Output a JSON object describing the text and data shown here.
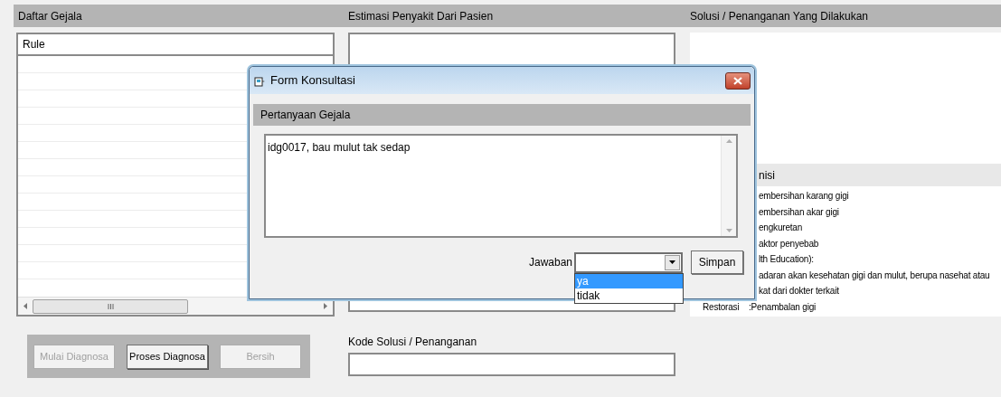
{
  "left_panel": {
    "title": "Daftar Gejala",
    "list": {
      "column": "Rule"
    },
    "buttons": [
      {
        "label": "Mulai Diagnosa",
        "disabled": true
      },
      {
        "label": "Proses Diagnosa",
        "disabled": false
      },
      {
        "label": "Bersih",
        "disabled": true
      }
    ]
  },
  "middle_panel": {
    "title": "Estimasi Penyakit Dari Pasien",
    "code_label": "Kode Solusi / Penanganan"
  },
  "right_panel": {
    "title": "Solusi / Penanganan Yang Dilakukan",
    "section_title": "nisi",
    "lines": [
      {
        "text": "embersihan karang gigi"
      },
      {
        "text": "embersihan akar gigi"
      },
      {
        "text": "engkuretan"
      },
      {
        "text": "aktor penyebab"
      },
      {
        "text": "lth Education):"
      },
      {
        "text": "adaran akan kesehatan gigi dan mulut, berupa nasehat atau"
      },
      {
        "text": "kat dari dokter terkait"
      },
      {
        "term": "Restorasi",
        "text": ":Penambalan gigi"
      }
    ]
  },
  "dialog": {
    "title": "Form Konsultasi",
    "section": "Pertanyaan Gejala",
    "question": "idg0017, bau mulut tak sedap",
    "answer_label": "Jawaban",
    "options": [
      {
        "label": "ya",
        "selected": true
      },
      {
        "label": "tidak",
        "selected": false
      }
    ],
    "save_button": "Simpan"
  }
}
